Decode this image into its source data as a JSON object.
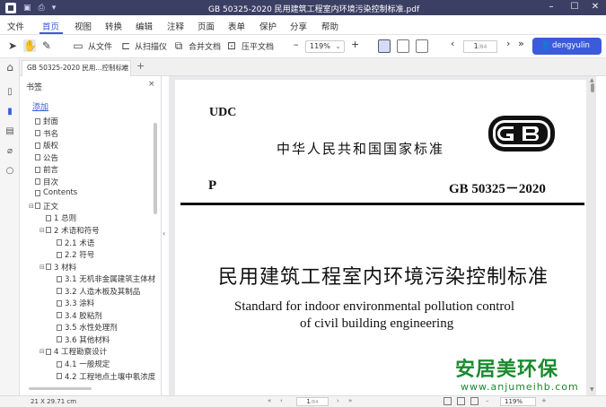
{
  "titlebar": {
    "title": "GB 50325-2020 民用建筑工程室内环境污染控制标准.pdf",
    "minimize": "–",
    "maximize": "☐",
    "close": "✕"
  },
  "menu": {
    "file": "文件",
    "items": [
      "首页",
      "视图",
      "转换",
      "编辑",
      "注释",
      "页面",
      "表单",
      "保护",
      "分享",
      "帮助"
    ]
  },
  "toolbar": {
    "from_file": "从文件",
    "from_scanner": "从扫描仪",
    "merge": "合并文档",
    "compress": "压平文档",
    "zoom_minus": "–",
    "zoom": "119%",
    "zoom_plus": "+",
    "prev": "‹",
    "page_current": "1",
    "page_total": "/84",
    "next": "›",
    "last": "»",
    "user": "dengyulin"
  },
  "tabs": {
    "doc_tab": "GB 50325-2020 民用...控制标准",
    "close": "×",
    "add": "+"
  },
  "bookmarks": {
    "header": "书签",
    "close": "×",
    "add": "添加",
    "collapse": "‹",
    "items": [
      {
        "label": "封面",
        "level": 0,
        "toggle": ""
      },
      {
        "label": "书名",
        "level": 0,
        "toggle": ""
      },
      {
        "label": "版权",
        "level": 0,
        "toggle": ""
      },
      {
        "label": "公告",
        "level": 0,
        "toggle": ""
      },
      {
        "label": "前言",
        "level": 0,
        "toggle": ""
      },
      {
        "label": "目次",
        "level": 0,
        "toggle": ""
      },
      {
        "label": "Contents",
        "level": 0,
        "toggle": ""
      },
      {
        "label": "正文",
        "level": 0,
        "toggle": "⊟"
      },
      {
        "label": "1 总则",
        "level": 1,
        "toggle": ""
      },
      {
        "label": "2 术语和符号",
        "level": 1,
        "toggle": "⊟"
      },
      {
        "label": "2.1 术语",
        "level": 2,
        "toggle": ""
      },
      {
        "label": "2.2 符号",
        "level": 2,
        "toggle": ""
      },
      {
        "label": "3 材料",
        "level": 1,
        "toggle": "⊟"
      },
      {
        "label": "3.1 无机非金属建筑主体材",
        "level": 2,
        "toggle": ""
      },
      {
        "label": "3.2 人造木板及其制品",
        "level": 2,
        "toggle": ""
      },
      {
        "label": "3.3 涂料",
        "level": 2,
        "toggle": ""
      },
      {
        "label": "3.4 胶粘剂",
        "level": 2,
        "toggle": ""
      },
      {
        "label": "3.5 水性处理剂",
        "level": 2,
        "toggle": ""
      },
      {
        "label": "3.6 其他材料",
        "level": 2,
        "toggle": ""
      },
      {
        "label": "4 工程勘察设计",
        "level": 1,
        "toggle": "⊟"
      },
      {
        "label": "4.1 一般规定",
        "level": 2,
        "toggle": ""
      },
      {
        "label": "4.2 工程地点土壤中氡浓度",
        "level": 2,
        "toggle": ""
      }
    ]
  },
  "document": {
    "udc": "UDC",
    "national_standard": "中华人民共和国国家标准",
    "p": "P",
    "code": "GB 50325－2020",
    "gb_logo": "GB",
    "title_cn": "民用建筑工程室内环境污染控制标准",
    "title_en_1": "Standard for indoor environmental pollution control",
    "title_en_2": "of civil building engineering"
  },
  "watermark": {
    "line1": "安居美环保",
    "line2": "www.anjumeihb.com"
  },
  "statusbar": {
    "dimensions": "21 X 29.71 cm",
    "first": "«",
    "prev": "‹",
    "page_current": "1",
    "page_total": "/84",
    "next": "›",
    "last": "»",
    "zoom": "119%"
  },
  "colors": {
    "titlebar": "#3b3f63",
    "accent": "#3b5bdb",
    "watermark": "#1a8a2e"
  }
}
